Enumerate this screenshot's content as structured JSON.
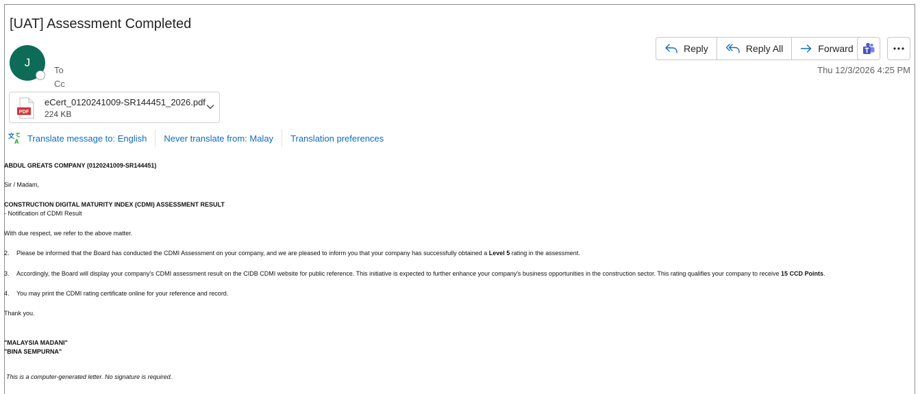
{
  "email": {
    "subject": "[UAT] Assessment Completed",
    "sender_initial": "J",
    "to_label": "To",
    "cc_label": "Cc",
    "timestamp": "Thu 12/3/2026 4:25 PM"
  },
  "actions": {
    "reply": "Reply",
    "reply_all": "Reply All",
    "forward": "Forward"
  },
  "attachment": {
    "file_name": "eCert_0120241009-SR144451_2026.pdf",
    "size": "224 KB",
    "type_label": "PDF"
  },
  "translation": {
    "translate": "Translate message to: English",
    "never": "Never translate from: Malay",
    "preferences": "Translation preferences"
  },
  "letter": {
    "company": "ABDUL GREATS COMPANY (0120241009-SR144451)",
    "salutation": "Sir / Madam,",
    "heading": "CONSTRUCTION DIGITAL MATURITY INDEX (CDMI) ASSESSMENT RESULT",
    "subheading": "- Notification of CDMI Result",
    "intro": "With due respect, we refer to the above matter.",
    "p2_num": "2.",
    "p2_text": "Please be informed that the Board has conducted the CDMI Assessment on your company, and we are pleased to inform you that your company has successfully obtained a ",
    "p2_bold": "Level 5",
    "p2_end": " rating in the assessment.",
    "p3_num": "3.",
    "p3_text": "Accordingly, the Board will display your company's CDMI assessment result on the CIDB CDMI website for public reference. This initiative is expected to further enhance your company's business opportunities in the construction sector. This rating qualifies your company to receive ",
    "p3_bold": "15 CCD Points",
    "p3_end": ".",
    "p4_num": "4.",
    "p4_text": "You may print the CDMI rating certificate online for your reference and record.",
    "thanks": "Thank you.",
    "motto1": "\"MALAYSIA MADANI\"",
    "motto2": "\"BINA SEMPURNA\"",
    "footer": "This is a computer-generated letter. No signature is required."
  }
}
